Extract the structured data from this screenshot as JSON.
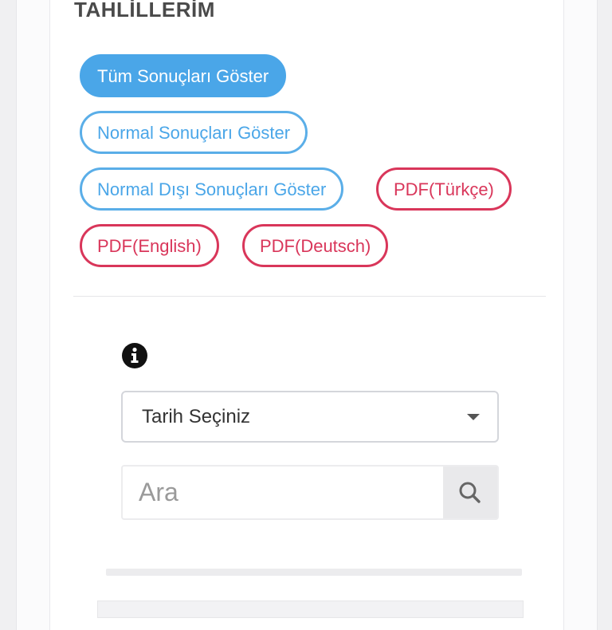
{
  "header": {
    "title": "TAHLİLLERİM"
  },
  "filters": [
    {
      "label": "Tüm Sonuçları Göster"
    },
    {
      "label": "Normal Sonuçları Göster"
    },
    {
      "label": "Normal Dışı Sonuçları Göster"
    }
  ],
  "pdf_buttons": [
    {
      "label": "PDF(Türkçe)"
    },
    {
      "label": "PDF(English)"
    },
    {
      "label": "PDF(Deutsch)"
    }
  ],
  "date_select": {
    "selected": "Tarih Seçiniz"
  },
  "search": {
    "placeholder": "Ara",
    "value": ""
  },
  "icons": {
    "info": "info-icon",
    "search": "search-icon",
    "dropdown": "chevron-down-icon"
  },
  "colors": {
    "primary": "#4aa6e8",
    "danger": "#d9365a"
  }
}
